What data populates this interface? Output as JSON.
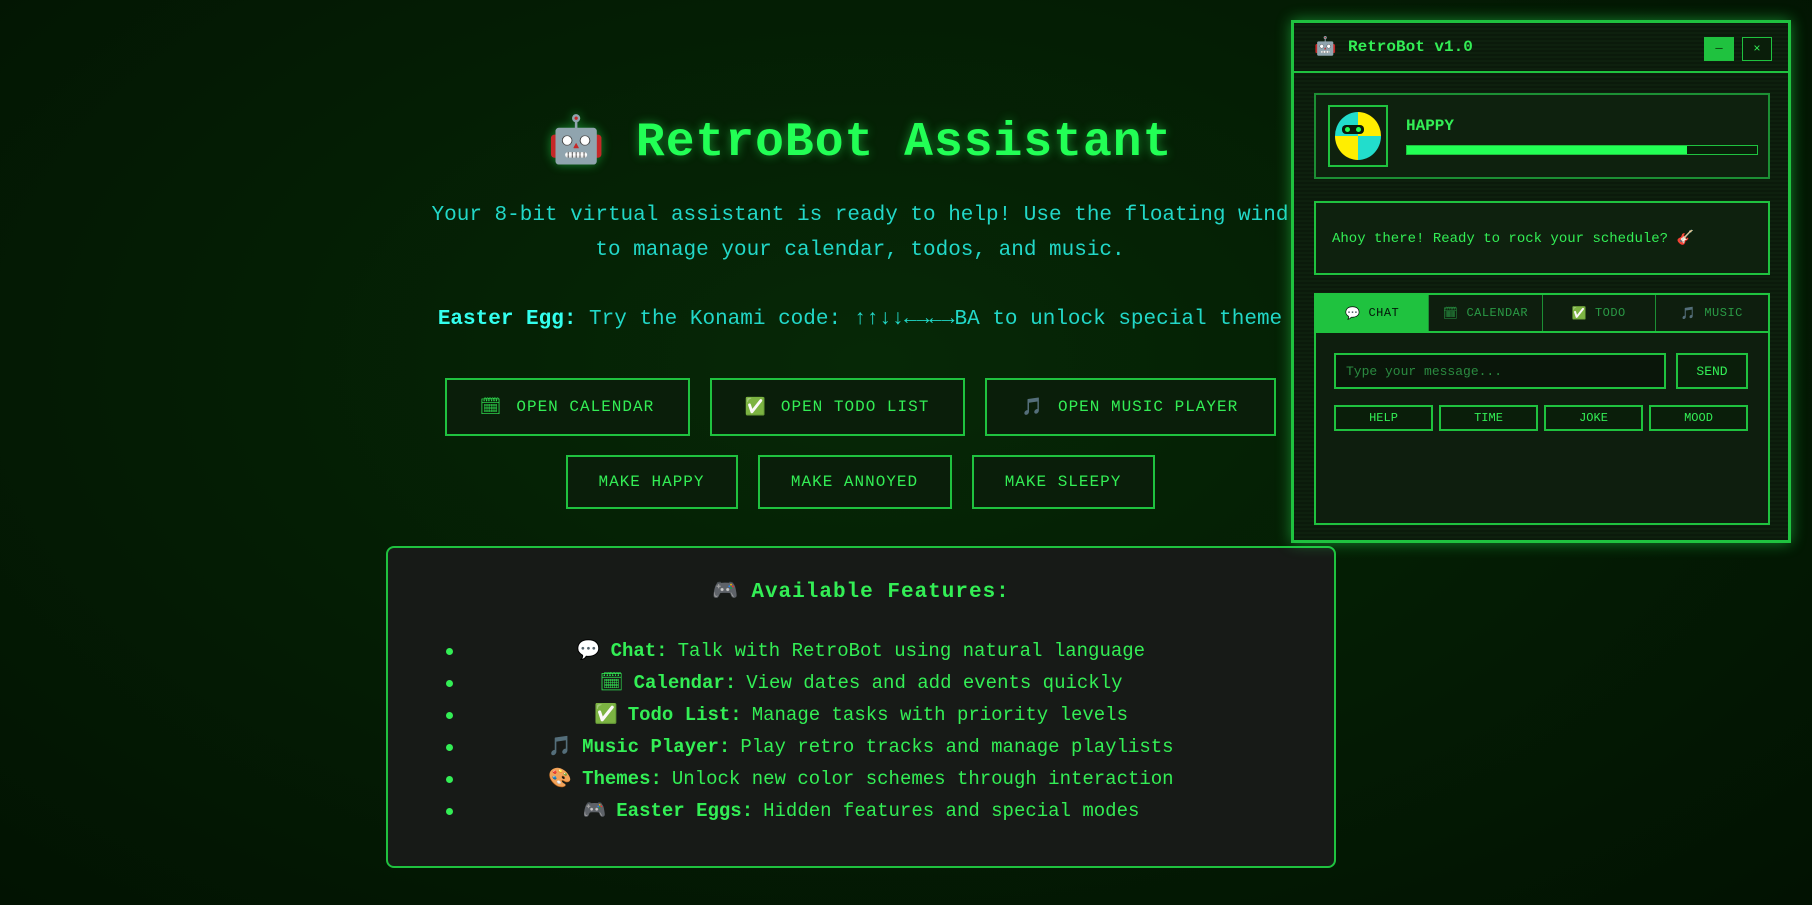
{
  "hero": {
    "emoji": "🤖",
    "title": "RetroBot Assistant",
    "subtitle_line1": "Your 8-bit virtual assistant is ready to help! Use the floating wind",
    "subtitle_line2": "to manage your calendar, todos, and music.",
    "easter_label": "Easter Egg:",
    "easter_text": "Try the Konami code: ↑↑↓↓←→←→BA to unlock special theme"
  },
  "buttons_row1": [
    {
      "icon": "🗓",
      "label": "OPEN CALENDAR"
    },
    {
      "icon": "✅",
      "label": "OPEN TODO LIST"
    },
    {
      "icon": "🎵",
      "label": "OPEN MUSIC PLAYER"
    }
  ],
  "buttons_row2": [
    {
      "label": "MAKE HAPPY"
    },
    {
      "label": "MAKE ANNOYED"
    },
    {
      "label": "MAKE SLEEPY"
    }
  ],
  "features": {
    "icon": "🎮",
    "title": "Available Features:",
    "items": [
      {
        "icon": "💬",
        "name": "Chat:",
        "desc": "Talk with RetroBot using natural language"
      },
      {
        "icon": "🗓",
        "name": "Calendar:",
        "desc": "View dates and add events quickly"
      },
      {
        "icon": "✅",
        "name": "Todo List:",
        "desc": "Manage tasks with priority levels"
      },
      {
        "icon": "🎵",
        "name": "Music Player:",
        "desc": "Play retro tracks and manage playlists"
      },
      {
        "icon": "🎨",
        "name": "Themes:",
        "desc": "Unlock new color schemes through interaction"
      },
      {
        "icon": "🎮",
        "name": "Easter Eggs:",
        "desc": "Hidden features and special modes"
      }
    ]
  },
  "window": {
    "icon": "🤖",
    "title": "RetroBot v1.0",
    "minimize": "─",
    "close": "×",
    "mood": "HAPPY",
    "mood_level": 0.8,
    "speech": "Ahoy there! Ready to rock your schedule?",
    "speech_emoji": "🎸",
    "tabs": [
      {
        "icon": "💬",
        "label": "CHAT",
        "active": true
      },
      {
        "icon": "🗓",
        "label": "CALENDAR",
        "active": false
      },
      {
        "icon": "✅",
        "label": "TODO",
        "active": false
      },
      {
        "icon": "🎵",
        "label": "MUSIC",
        "active": false
      }
    ],
    "input_placeholder": "Type your message...",
    "send_label": "SEND",
    "quick_actions": [
      "HELP",
      "TIME",
      "JOKE",
      "MOOD"
    ]
  },
  "colors": {
    "accent": "#1fc23f",
    "text_green": "#33ee55",
    "text_cyan": "#22d8c8",
    "background": "#041c04"
  }
}
